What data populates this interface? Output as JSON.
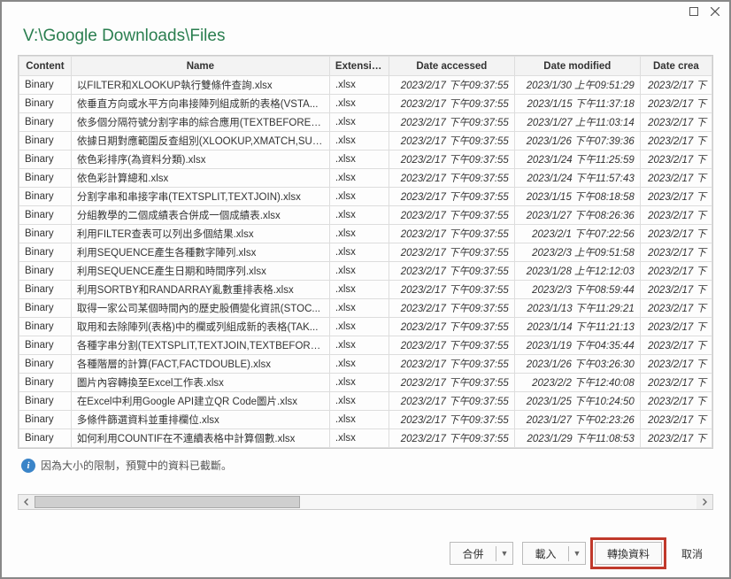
{
  "window": {
    "path": "V:\\Google Downloads\\Files"
  },
  "columns": {
    "content": "Content",
    "name": "Name",
    "ext": "Extension",
    "accessed": "Date accessed",
    "modified": "Date modified",
    "created": "Date crea"
  },
  "rows": [
    {
      "content": "Binary",
      "name": "以FILTER和XLOOKUP執行雙條件查詢.xlsx",
      "ext": ".xlsx",
      "accessed": "2023/2/17 下午09:37:55",
      "modified": "2023/1/30 上午09:51:29",
      "created": "2023/2/17 下"
    },
    {
      "content": "Binary",
      "name": "依垂直方向或水平方向串接陣列組成新的表格(VSTA...",
      "ext": ".xlsx",
      "accessed": "2023/2/17 下午09:37:55",
      "modified": "2023/1/15 下午11:37:18",
      "created": "2023/2/17 下"
    },
    {
      "content": "Binary",
      "name": "依多個分隔符號分割字串的綜合應用(TEXTBEFORE,T...",
      "ext": ".xlsx",
      "accessed": "2023/2/17 下午09:37:55",
      "modified": "2023/1/27 上午11:03:14",
      "created": "2023/2/17 下"
    },
    {
      "content": "Binary",
      "name": "依據日期對應範圍反查組別(XLOOKUP,XMATCH,SUM...",
      "ext": ".xlsx",
      "accessed": "2023/2/17 下午09:37:55",
      "modified": "2023/1/26 下午07:39:36",
      "created": "2023/2/17 下"
    },
    {
      "content": "Binary",
      "name": "依色彩排序(為資料分類).xlsx",
      "ext": ".xlsx",
      "accessed": "2023/2/17 下午09:37:55",
      "modified": "2023/1/24 下午11:25:59",
      "created": "2023/2/17 下"
    },
    {
      "content": "Binary",
      "name": "依色彩計算總和.xlsx",
      "ext": ".xlsx",
      "accessed": "2023/2/17 下午09:37:55",
      "modified": "2023/1/24 下午11:57:43",
      "created": "2023/2/17 下"
    },
    {
      "content": "Binary",
      "name": "分割字串和串接字串(TEXTSPLIT,TEXTJOIN).xlsx",
      "ext": ".xlsx",
      "accessed": "2023/2/17 下午09:37:55",
      "modified": "2023/1/15 下午08:18:58",
      "created": "2023/2/17 下"
    },
    {
      "content": "Binary",
      "name": "分組教學的二個成績表合併成一個成績表.xlsx",
      "ext": ".xlsx",
      "accessed": "2023/2/17 下午09:37:55",
      "modified": "2023/1/27 下午08:26:36",
      "created": "2023/2/17 下"
    },
    {
      "content": "Binary",
      "name": "利用FILTER查表可以列出多個結果.xlsx",
      "ext": ".xlsx",
      "accessed": "2023/2/17 下午09:37:55",
      "modified": "2023/2/1 下午07:22:56",
      "created": "2023/2/17 下"
    },
    {
      "content": "Binary",
      "name": "利用SEQUENCE產生各種數字陣列.xlsx",
      "ext": ".xlsx",
      "accessed": "2023/2/17 下午09:37:55",
      "modified": "2023/2/3 上午09:51:58",
      "created": "2023/2/17 下"
    },
    {
      "content": "Binary",
      "name": "利用SEQUENCE產生日期和時間序列.xlsx",
      "ext": ".xlsx",
      "accessed": "2023/2/17 下午09:37:55",
      "modified": "2023/1/28 上午12:12:03",
      "created": "2023/2/17 下"
    },
    {
      "content": "Binary",
      "name": "利用SORTBY和RANDARRAY亂數重排表格.xlsx",
      "ext": ".xlsx",
      "accessed": "2023/2/17 下午09:37:55",
      "modified": "2023/2/3 下午08:59:44",
      "created": "2023/2/17 下"
    },
    {
      "content": "Binary",
      "name": "取得一家公司某個時間內的歷史股價變化資訊(STOC...",
      "ext": ".xlsx",
      "accessed": "2023/2/17 下午09:37:55",
      "modified": "2023/1/13 下午11:29:21",
      "created": "2023/2/17 下"
    },
    {
      "content": "Binary",
      "name": "取用和去除陣列(表格)中的欄或列組成新的表格(TAK...",
      "ext": ".xlsx",
      "accessed": "2023/2/17 下午09:37:55",
      "modified": "2023/1/14 下午11:21:13",
      "created": "2023/2/17 下"
    },
    {
      "content": "Binary",
      "name": "各種字串分割(TEXTSPLIT,TEXTJOIN,TEXTBEFORE,TEXT...",
      "ext": ".xlsx",
      "accessed": "2023/2/17 下午09:37:55",
      "modified": "2023/1/19 下午04:35:44",
      "created": "2023/2/17 下"
    },
    {
      "content": "Binary",
      "name": "各種階層的計算(FACT,FACTDOUBLE).xlsx",
      "ext": ".xlsx",
      "accessed": "2023/2/17 下午09:37:55",
      "modified": "2023/1/26 下午03:26:30",
      "created": "2023/2/17 下"
    },
    {
      "content": "Binary",
      "name": "圖片內容轉換至Excel工作表.xlsx",
      "ext": ".xlsx",
      "accessed": "2023/2/17 下午09:37:55",
      "modified": "2023/2/2 下午12:40:08",
      "created": "2023/2/17 下"
    },
    {
      "content": "Binary",
      "name": "在Excel中利用Google API建立QR Code圖片.xlsx",
      "ext": ".xlsx",
      "accessed": "2023/2/17 下午09:37:55",
      "modified": "2023/1/25 下午10:24:50",
      "created": "2023/2/17 下"
    },
    {
      "content": "Binary",
      "name": "多條件篩選資料並重排欄位.xlsx",
      "ext": ".xlsx",
      "accessed": "2023/2/17 下午09:37:55",
      "modified": "2023/1/27 下午02:23:26",
      "created": "2023/2/17 下"
    },
    {
      "content": "Binary",
      "name": "如何利用COUNTIF在不連續表格中計算個數.xlsx",
      "ext": ".xlsx",
      "accessed": "2023/2/17 下午09:37:55",
      "modified": "2023/1/29 下午11:08:53",
      "created": "2023/2/17 下"
    }
  ],
  "info_text": "因為大小的限制，預覽中的資料已截斷。",
  "buttons": {
    "combine": "合併",
    "load": "載入",
    "transform": "轉換資料",
    "cancel": "取消"
  }
}
